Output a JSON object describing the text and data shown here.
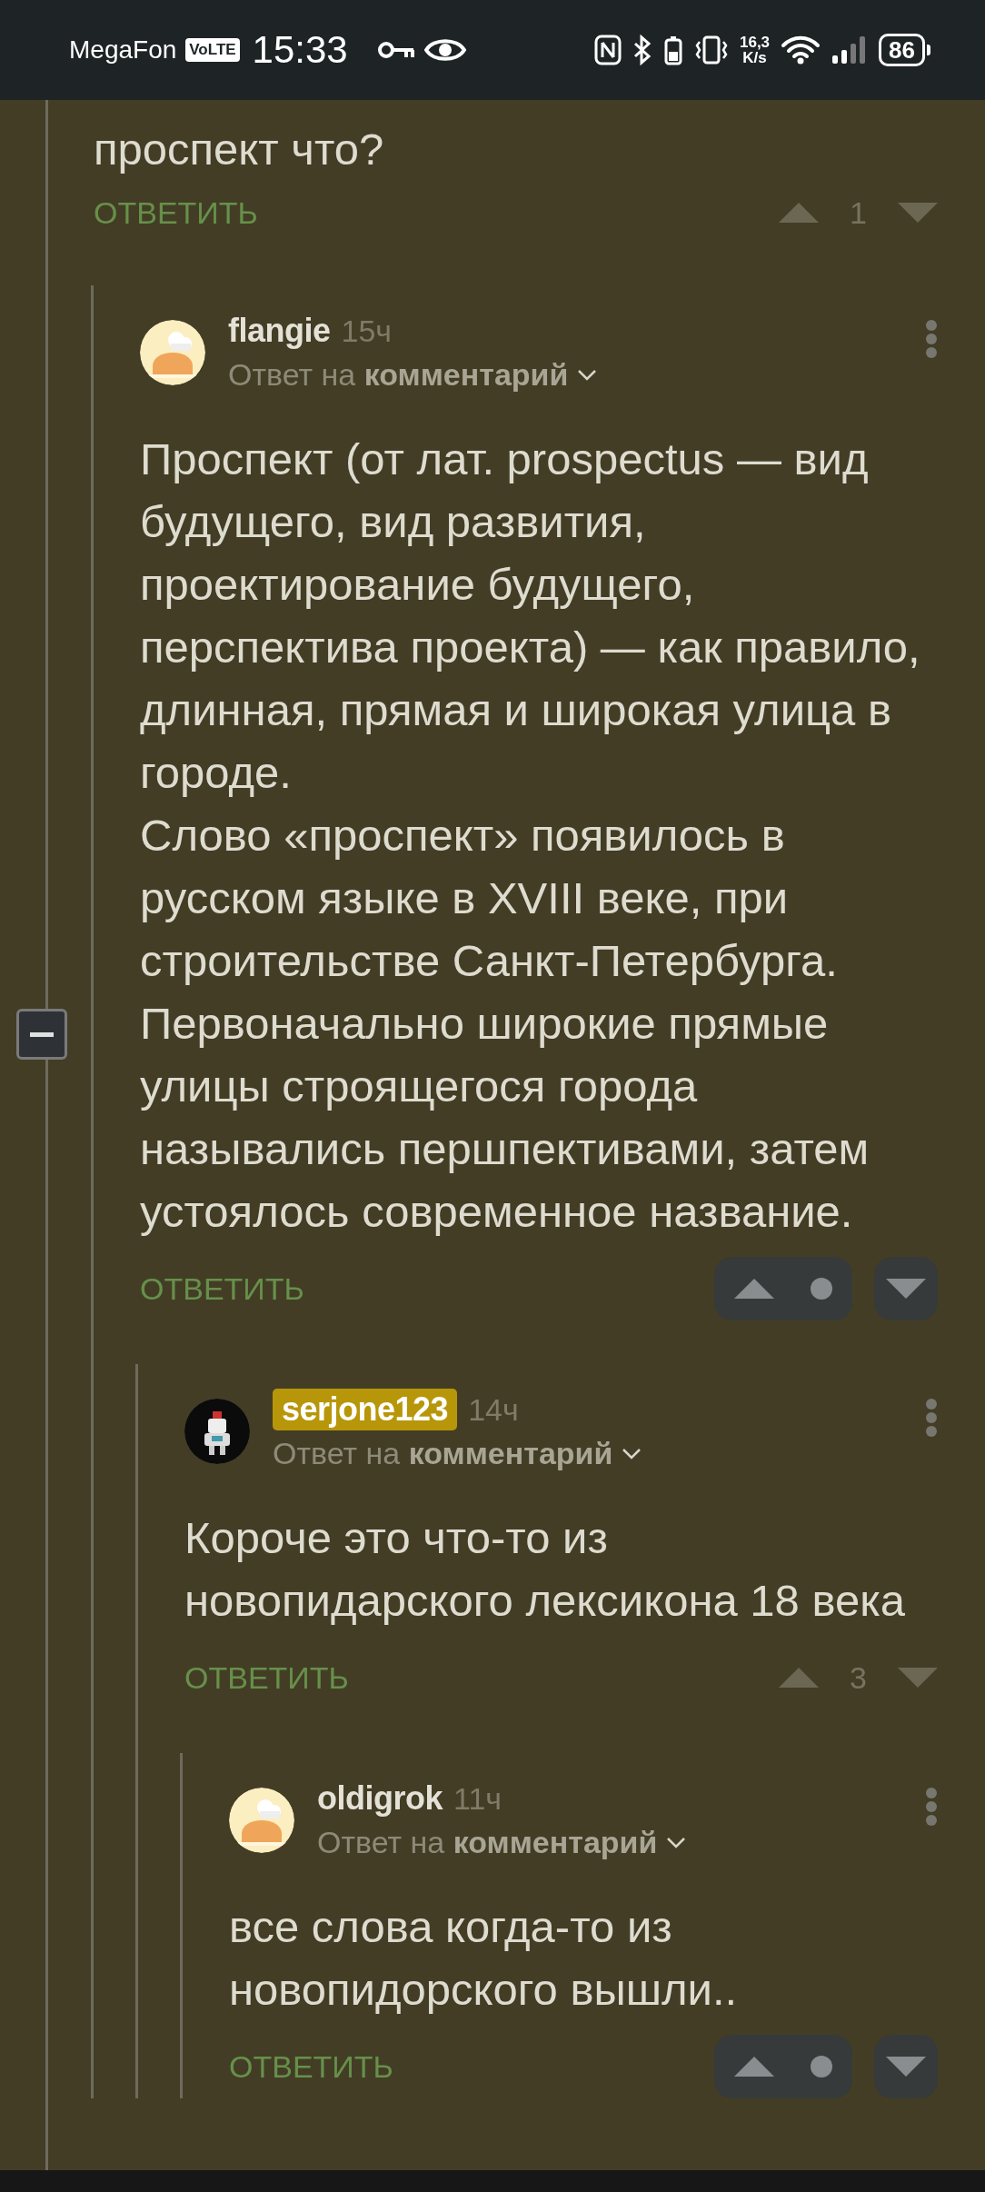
{
  "status_bar": {
    "carrier": "MegaFon",
    "volte": "VoLTE",
    "time": "15:33",
    "speed_value": "16,3",
    "speed_unit": "K/s",
    "battery": "86"
  },
  "thread": {
    "text": "проспект что?",
    "reply_label": "ОТВЕТИТЬ",
    "votes": {
      "kind": "count",
      "rating": "1"
    },
    "children": [
      {
        "author": "flangie",
        "author_highlighted": false,
        "avatar": {
          "color": "#fbeec0"
        },
        "time": "15ч",
        "reply_to": "Ответ на **комментарий**",
        "text": "Проспект (от лат. prospectus — вид будущего, вид развития, проектирование будущего, перспектива проекта) — как правило, длинная, прямая и широкая улица в городе.\nСлово «проспект» появилось в русском языке в XVIII веке, при строительстве Санкт-Петербурга. Первоначально широкие прямые улицы строящегося города назывались першпективами, затем устоялось современное название.",
        "reply_label": "ОТВЕТИТЬ",
        "votes": {
          "kind": "hidden"
        },
        "collapsible": true,
        "children": [
          {
            "author": "serjone123",
            "author_highlighted": true,
            "avatar": {
              "color": "#0b0b0b"
            },
            "time": "14ч",
            "reply_to": "Ответ на **комментарий**",
            "text": "Короче это что-то из новопидарского лексикона 18 века",
            "reply_label": "ОТВЕТИТЬ",
            "votes": {
              "kind": "count",
              "rating": "3"
            },
            "children": [
              {
                "author": "oldigrok",
                "author_highlighted": false,
                "avatar": {
                  "color": "#fbeec0"
                },
                "time": "11ч",
                "reply_to": "Ответ на **комментарий**",
                "text": "все слова когда-то из новопидорского вышли..",
                "reply_label": "ОТВЕТИТЬ",
                "votes": {
                  "kind": "hidden"
                }
              }
            ]
          }
        ]
      }
    ]
  }
}
